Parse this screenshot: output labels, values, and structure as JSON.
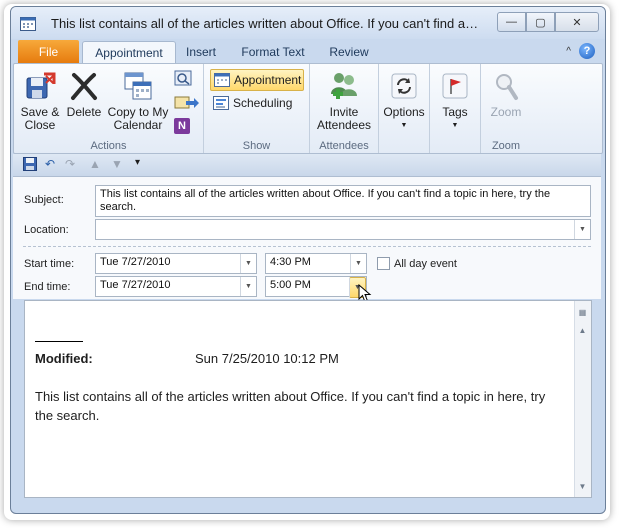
{
  "window": {
    "title": "This list contains all of the articles written about Office. If you can't find a topic i...",
    "controls": {
      "minimize": "—",
      "maximize": "▢",
      "close": "✕"
    }
  },
  "tabs": {
    "file": "File",
    "appointment": "Appointment",
    "insert": "Insert",
    "format_text": "Format Text",
    "review": "Review"
  },
  "ribbon": {
    "actions": {
      "label": "Actions",
      "save_close_1": "Save &",
      "save_close_2": "Close",
      "delete": "Delete",
      "copy_1": "Copy to My",
      "copy_2": "Calendar"
    },
    "show": {
      "label": "Show",
      "appointment": "Appointment",
      "scheduling": "Scheduling"
    },
    "attendees": {
      "label": "Attendees",
      "invite_1": "Invite",
      "invite_2": "Attendees"
    },
    "options": {
      "label": "Options"
    },
    "tags": {
      "label": "Tags"
    },
    "zoom": {
      "label": "Zoom",
      "button": "Zoom"
    }
  },
  "form": {
    "subject_label": "Subject:",
    "subject_value": "This list contains all of the articles written about Office. If you can't find a topic in here, try the search.",
    "location_label": "Location:",
    "location_value": "",
    "start_label": "Start time:",
    "start_date": "Tue 7/27/2010",
    "start_time": "4:30 PM",
    "all_day": "All day event",
    "end_label": "End time:",
    "end_date": "Tue 7/27/2010",
    "end_time": "5:00 PM"
  },
  "body": {
    "modified_label": "Modified:",
    "modified_value": "Sun 7/25/2010 10:12 PM",
    "text": "This list contains all of the articles written about Office. If you can't find a topic in here, try the search."
  }
}
